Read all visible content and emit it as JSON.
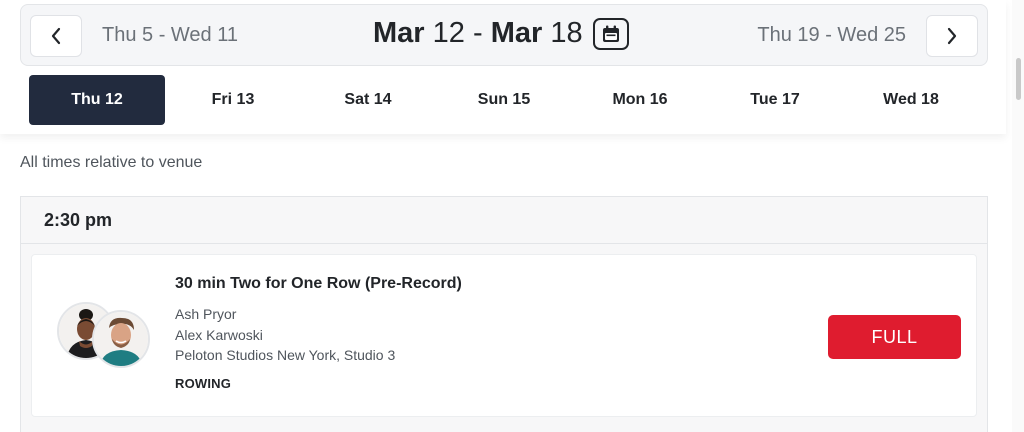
{
  "week_nav": {
    "prev_range": "Thu 5 - Wed 11",
    "current_start": "Mar 12",
    "current_sep": " - ",
    "current_end": "Mar 18",
    "next_range": "Thu 19 - Wed 25",
    "prev_icon": "chevron-left-icon",
    "next_icon": "chevron-right-icon",
    "calendar_icon": "calendar-icon"
  },
  "day_tabs": [
    {
      "label": "Thu 12",
      "active": true
    },
    {
      "label": "Fri 13",
      "active": false
    },
    {
      "label": "Sat 14",
      "active": false
    },
    {
      "label": "Sun 15",
      "active": false
    },
    {
      "label": "Mon 16",
      "active": false
    },
    {
      "label": "Tue 17",
      "active": false
    },
    {
      "label": "Wed 18",
      "active": false
    }
  ],
  "timezone_note": "All times relative to venue",
  "schedule": {
    "time_slot": "2:30 pm",
    "classes": [
      {
        "title": "30 min Two for One Row (Pre-Record)",
        "instructor_1": "Ash Pryor",
        "instructor_2": "Alex Karwoski",
        "location": "Peloton Studios New York, Studio 3",
        "discipline": "ROWING",
        "action_label": "FULL"
      }
    ]
  },
  "colors": {
    "active_tab": "#222b3e",
    "full_button": "#df1c2f",
    "text_primary": "#222529",
    "text_secondary": "#4f555c"
  }
}
